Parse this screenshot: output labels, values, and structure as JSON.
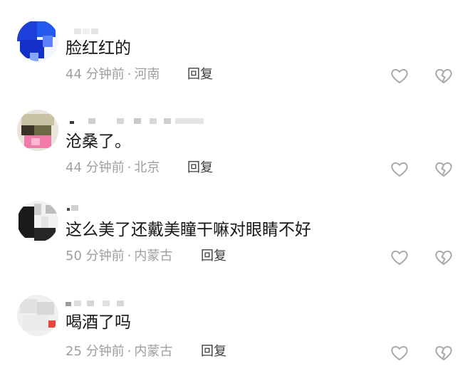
{
  "comments": [
    {
      "text": "脸红红的",
      "time": "44 分钟前",
      "location": "河南",
      "reply_label": "回复",
      "like_icon": "heart-outline-icon",
      "dislike_icon": "broken-heart-icon"
    },
    {
      "text": "沧桑了。",
      "time": "44 分钟前",
      "location": "北京",
      "reply_label": "回复",
      "like_icon": "heart-outline-icon",
      "dislike_icon": "broken-heart-icon"
    },
    {
      "text": "这么美了还戴美瞳干嘛对眼睛不好",
      "time": "50 分钟前",
      "location": "内蒙古",
      "reply_label": "回复",
      "like_icon": "heart-outline-icon",
      "dislike_icon": "broken-heart-icon"
    },
    {
      "text": "喝酒了吗",
      "time": "25 分钟前",
      "location": "内蒙古",
      "reply_label": "回复",
      "like_icon": "heart-outline-icon",
      "dislike_icon": "broken-heart-icon"
    }
  ],
  "colors": {
    "text": "#161616",
    "meta": "#9e9e9e",
    "icon": "#a8a8a8",
    "avatar1": "#1b3fd8",
    "avatar2": "#f07aa8",
    "avatar3": "#1a1a1a",
    "avatar4_badge": "#e8453c"
  }
}
